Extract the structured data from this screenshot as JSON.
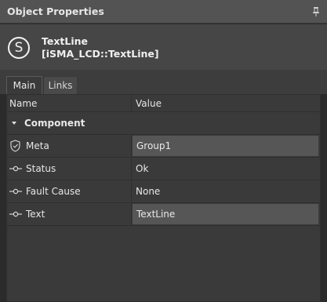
{
  "panel": {
    "title": "Object Properties",
    "pin_icon": "pin-icon"
  },
  "object": {
    "icon_letter": "S",
    "name": "TextLine",
    "type": "[iSMA_LCD::TextLine]"
  },
  "tabs": [
    {
      "label": "Main",
      "active": true
    },
    {
      "label": "Links",
      "active": false
    }
  ],
  "grid": {
    "columns": [
      "Name",
      "Value"
    ],
    "group": {
      "label": "Component",
      "expanded": true
    },
    "rows": [
      {
        "icon": "shield-icon",
        "name": "Meta",
        "value": "Group1",
        "editable": true
      },
      {
        "icon": "slot-icon",
        "name": "Status",
        "value": "Ok",
        "editable": false
      },
      {
        "icon": "slot-icon",
        "name": "Fault Cause",
        "value": "None",
        "editable": false
      },
      {
        "icon": "slot-icon",
        "name": "Text",
        "value": "TextLine",
        "editable": true
      }
    ]
  }
}
